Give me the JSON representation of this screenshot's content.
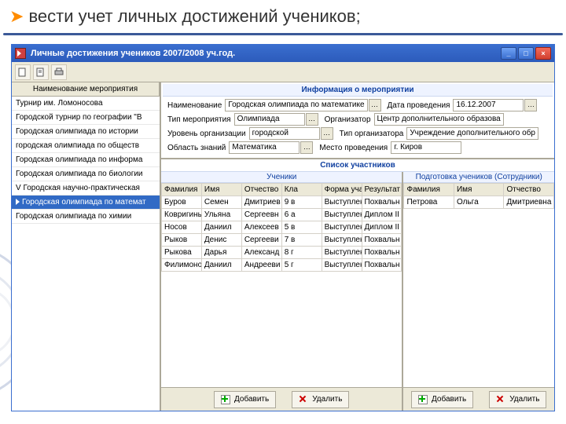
{
  "slide": {
    "heading": "вести учет личных достижений учеников;"
  },
  "window": {
    "title": "Личные достижения учеников 2007/2008 уч.год.",
    "min": "_",
    "max": "□",
    "close": "×"
  },
  "left_list": {
    "header": "Наименование мероприятия",
    "items": [
      "Турнир им. Ломоносова",
      "Городской турнир по географии \"В",
      "Городская олимпиада по истории",
      "городская олимпиада по обществ",
      "Городская олимпиада по информа",
      "Городская олимпиада по биологии",
      "V Городская научно-практическая",
      "Городская олимпиада по математ",
      "Городская олимпиада по химии"
    ],
    "selected_index": 7
  },
  "info": {
    "title": "Информация о мероприятии",
    "rows": [
      {
        "label": "Наименование",
        "value": "Городская олимпиада по математике",
        "dots": true
      },
      {
        "label": "Дата проведения",
        "value": "16.12.2007",
        "dots": true
      },
      {
        "label": "Тип мероприятия",
        "value": "Олимпиада",
        "dots": true
      },
      {
        "label": "Организатор",
        "value": "Центр дополнительного образова",
        "dots": false
      },
      {
        "label": "Уровень организации",
        "value": "городской",
        "dots": true
      },
      {
        "label": "Тип организатора",
        "value": "Учреждение дополнительного обр",
        "dots": false
      },
      {
        "label": "Область знаний",
        "value": "Математика",
        "dots": true
      },
      {
        "label": "Место проведения",
        "value": "г. Киров",
        "dots": false
      }
    ]
  },
  "participants": {
    "title": "Список участников",
    "left": {
      "subhead": "Ученики",
      "columns": [
        "Фамилия",
        "Имя",
        "Отчество",
        "Кла",
        "Форма участия",
        "Результат"
      ],
      "rows": [
        [
          "Буров",
          "Семен",
          "Дмитриев",
          "9 в",
          "Выступление",
          "Похвальн"
        ],
        [
          "Ковригиных",
          "Ульяна",
          "Сергеевн",
          "6 а",
          "Выступление",
          "Диплом II"
        ],
        [
          "Носов",
          "Даниил",
          "Алексеев",
          "5 в",
          "Выступление",
          "Диплом II с"
        ],
        [
          "Рыков",
          "Денис",
          "Сергееви",
          "7 в",
          "Выступление",
          "Похвальн"
        ],
        [
          "Рыкова",
          "Дарья",
          "Александ",
          "8 г",
          "Выступление",
          "Похвальн"
        ],
        [
          "Филимонов",
          "Даниил",
          "Андрееви",
          "5 г",
          "Выступление",
          "Похвальн"
        ]
      ]
    },
    "right": {
      "subhead": "Подготовка учеников (Сотрудники)",
      "columns": [
        "Фамилия",
        "Имя",
        "Отчество"
      ],
      "rows": [
        [
          "Петрова",
          "Ольга",
          "Дмитриевна"
        ]
      ]
    }
  },
  "buttons": {
    "add": "Добавить",
    "del": "Удалить"
  }
}
